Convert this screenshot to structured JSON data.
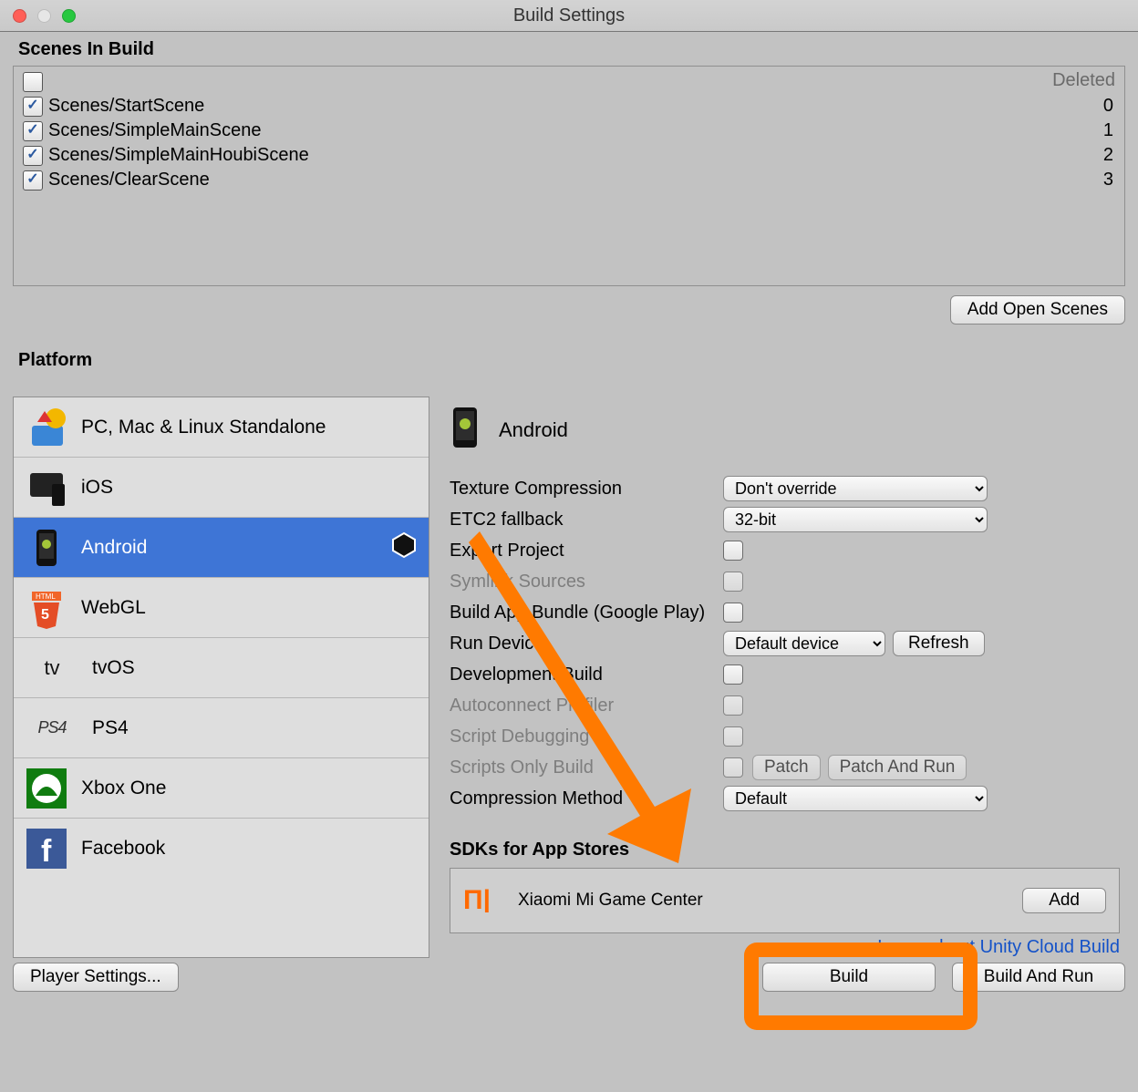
{
  "window": {
    "title": "Build Settings"
  },
  "scenes": {
    "header": "Scenes In Build",
    "deleted_label": "Deleted",
    "items": [
      {
        "checked": true,
        "path": "Scenes/StartScene",
        "index": "0"
      },
      {
        "checked": true,
        "path": "Scenes/SimpleMainScene",
        "index": "1"
      },
      {
        "checked": true,
        "path": "Scenes/SimpleMainHoubiScene",
        "index": "2"
      },
      {
        "checked": true,
        "path": "Scenes/ClearScene",
        "index": "3"
      }
    ],
    "add_button": "Add Open Scenes"
  },
  "platform": {
    "header": "Platform",
    "items": [
      {
        "label": "PC, Mac & Linux Standalone"
      },
      {
        "label": "iOS"
      },
      {
        "label": "Android",
        "selected": true
      },
      {
        "label": "WebGL"
      },
      {
        "label": "tvOS"
      },
      {
        "label": "PS4"
      },
      {
        "label": "Xbox One"
      },
      {
        "label": "Facebook"
      }
    ]
  },
  "panel": {
    "title": "Android",
    "texture_compression": {
      "label": "Texture Compression",
      "value": "Don't override"
    },
    "etc2_fallback": {
      "label": "ETC2 fallback",
      "value": "32-bit"
    },
    "export_project": {
      "label": "Export Project"
    },
    "symlink_sources": {
      "label": "Symlink Sources"
    },
    "build_app_bundle": {
      "label": "Build App Bundle (Google Play)"
    },
    "run_device": {
      "label": "Run Device",
      "value": "Default device",
      "refresh": "Refresh"
    },
    "development_build": {
      "label": "Development Build"
    },
    "autoconnect_profiler": {
      "label": "Autoconnect Profiler"
    },
    "script_debugging": {
      "label": "Script Debugging"
    },
    "scripts_only_build": {
      "label": "Scripts Only Build",
      "patch": "Patch",
      "patch_and_run": "Patch And Run"
    },
    "compression_method": {
      "label": "Compression Method",
      "value": "Default"
    },
    "sdks_header": "SDKs for App Stores",
    "sdk": {
      "name": "Xiaomi Mi Game Center",
      "add": "Add"
    },
    "cloud_link": "Learn about Unity Cloud Build"
  },
  "footer": {
    "player_settings": "Player Settings...",
    "build": "Build",
    "build_and_run": "Build And Run"
  }
}
